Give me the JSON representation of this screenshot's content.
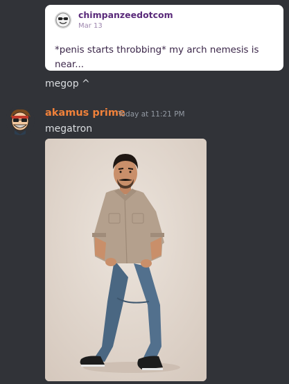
{
  "embed": {
    "author": "chimpanzeedotcom",
    "date": "Mar 13",
    "text": "*penis starts throbbing* my arch nemesis is near...",
    "avatar_icon": "sunglasses-smiley-icon"
  },
  "reply": {
    "text": "megop ^"
  },
  "message": {
    "author": "akamus prime",
    "author_color": "#f0813a",
    "timestamp": "Today at 11:21 PM",
    "text": "megatron",
    "avatar_icon": "cartoon-face-avatar",
    "attachment_icon": "photo-of-man-posing"
  },
  "colors": {
    "background": "#313338",
    "text": "#dbdee1",
    "muted": "#949ba4"
  }
}
